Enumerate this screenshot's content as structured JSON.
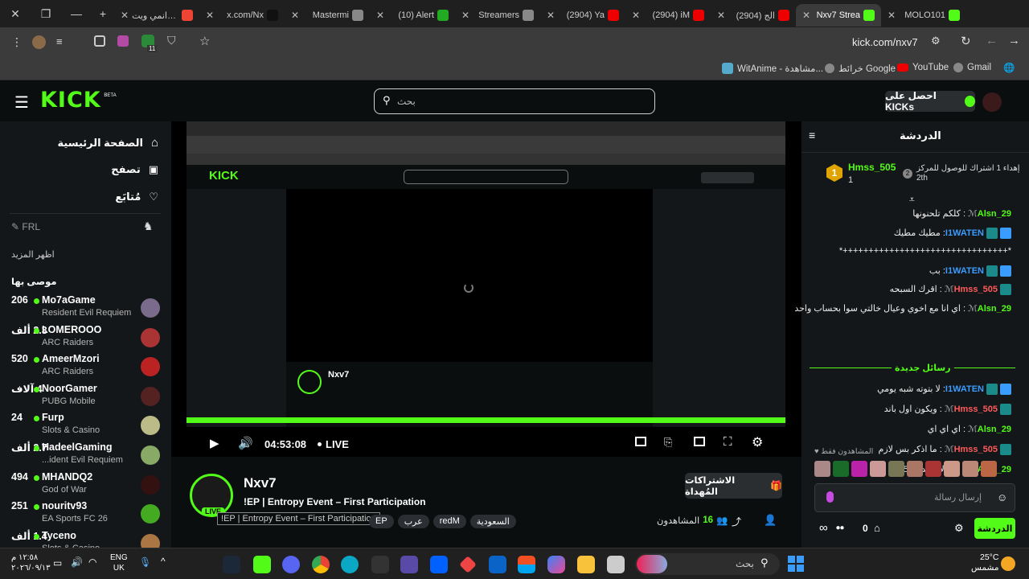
{
  "browser": {
    "tabs": [
      {
        "title": "انمي ويتraku",
        "fav": "#e43"
      },
      {
        "title": "x.com/Nx",
        "fav": "#111"
      },
      {
        "title": "Mastermi",
        "fav": "#888"
      },
      {
        "title": "(10) Alert",
        "fav": "#2a2"
      },
      {
        "title": "Streamers",
        "fav": "#888"
      },
      {
        "title": "(2904) Ya",
        "fav": "#e00"
      },
      {
        "title": "(2904) iM",
        "fav": "#e00"
      },
      {
        "title": "(2904) الج",
        "fav": "#e00"
      },
      {
        "title": "Nxv7 Strea",
        "fav": "#53fc18"
      },
      {
        "title": "MOLO101",
        "fav": "#53fc18"
      }
    ],
    "url": "kick.com/nxv7",
    "bookmarks": [
      "WitAnime - مشاهدة...",
      "خرائط Google",
      "YouTube",
      "Gmail"
    ],
    "extension_count": "11"
  },
  "kick": {
    "logo": "KICK",
    "logo_beta": "BETA",
    "search_placeholder": "بحث",
    "get_kicks": "احصل على KICKs",
    "nav": {
      "home": "الصفحة الرئيسية",
      "browse": "تصفح",
      "following": "مُتابَع"
    },
    "frl": "FRL",
    "show_more": "اظهر المزيد",
    "recommended": "موصى بها",
    "channels": [
      {
        "name": "Mo7aGame",
        "game": "Resident Evil Requiem",
        "viewers": "206",
        "color": "#7a6b8c"
      },
      {
        "name": "LOMEROOO",
        "game": "ARC Raiders",
        "viewers": "2.3 ألف",
        "color": "#a33"
      },
      {
        "name": "AmeerMzori",
        "game": "ARC Raiders",
        "viewers": "520",
        "color": "#b22"
      },
      {
        "name": "NoorGamer",
        "game": "PUBG Mobile",
        "viewers": "4 آلاف",
        "color": "#522"
      },
      {
        "name": "Furp",
        "game": "Slots & Casino",
        "viewers": "24",
        "color": "#bb8"
      },
      {
        "name": "HadeelGaming",
        "game": "...ident Evil Requiem",
        "viewers": "2.7 ألف",
        "color": "#8a6"
      },
      {
        "name": "MHANDQ2",
        "game": "God of War",
        "viewers": "494",
        "color": "#311"
      },
      {
        "name": "nouritv93",
        "game": "EA Sports FC 26",
        "viewers": "251",
        "color": "#4a2"
      },
      {
        "name": "Tyceno",
        "game": "Slots & Casino",
        "viewers": "1.4 ألف",
        "color": "#a74"
      }
    ],
    "player": {
      "time": "04:53:08",
      "live": "LIVE"
    },
    "stream": {
      "streamer": "Nxv7",
      "title": "!EP | Entropy Event – First Participation",
      "tooltip": "!EP | Entropy Event – First Participation",
      "tags": [
        "EP",
        "عرب",
        "redM",
        "السعودية"
      ],
      "viewers_label": "المشاهدون",
      "viewers": "16",
      "live_badge": "LIVE",
      "gift_subs": "الاشتراكات المُهداة"
    },
    "chat": {
      "title": "الدردشة",
      "pinned": {
        "user": "Hmss_505",
        "rank": "1",
        "count": "1",
        "text": "إهداء 1 اشتراك للوصول للمركز",
        "place": "2th",
        "place_num": "2"
      },
      "messages": [
        {
          "user": "Alsn_29",
          "text": "كلكم تلحنونها",
          "color": "#53fc18",
          "badges": 0
        },
        {
          "user": "I1WATEN",
          "text": "مطيك مطيك",
          "color": "#3b9cff",
          "badges": 2
        },
        {
          "user": "",
          "text": "*++++++++++++++++++++++++++++++++*",
          "color": "#fff",
          "badges": 0
        },
        {
          "user": "I1WATEN",
          "text": "بب",
          "color": "#3b9cff",
          "badges": 2
        },
        {
          "user": "Hmss_505",
          "text": "اقرك السبحه",
          "color": "#ff5a5a",
          "badges": 1
        },
        {
          "user": "Alsn_29",
          "text": "اي انا مع اخوي وعيال خالتي سوا بحساب واحد",
          "color": "#53fc18",
          "badges": 0
        }
      ],
      "new_messages": "رسائل جديدة",
      "new": [
        {
          "user": "I1WATEN",
          "text": "لا بتوته شبه يومي",
          "color": "#3b9cff",
          "badges": 2
        },
        {
          "user": "Hmss_505",
          "text": "ويكون اول باند",
          "color": "#ff5a5a",
          "badges": 1
        },
        {
          "user": "Alsn_29",
          "text": "اي اي اي",
          "color": "#53fc18",
          "badges": 0
        },
        {
          "user": "Hmss_505",
          "text": "ما اذكر بس لازم",
          "color": "#ff5a5a",
          "badges": 1
        },
        {
          "user": "Alsn_29",
          "text": "بس لا يتحدون 5",
          "color": "#53fc18",
          "badges": 0
        }
      ],
      "viewers_only": "المشاهدون فقط",
      "input_placeholder": "إرسال رسالة",
      "points": "0",
      "send": "الدردشة"
    }
  },
  "taskbar": {
    "time": "١٢:٥٨ م",
    "date": "٢٠٢٦/٠٩/١٣",
    "lang1": "ENG",
    "lang2": "UK",
    "search": "بحث",
    "weather_temp": "25°C",
    "weather_desc": "مشمس"
  }
}
